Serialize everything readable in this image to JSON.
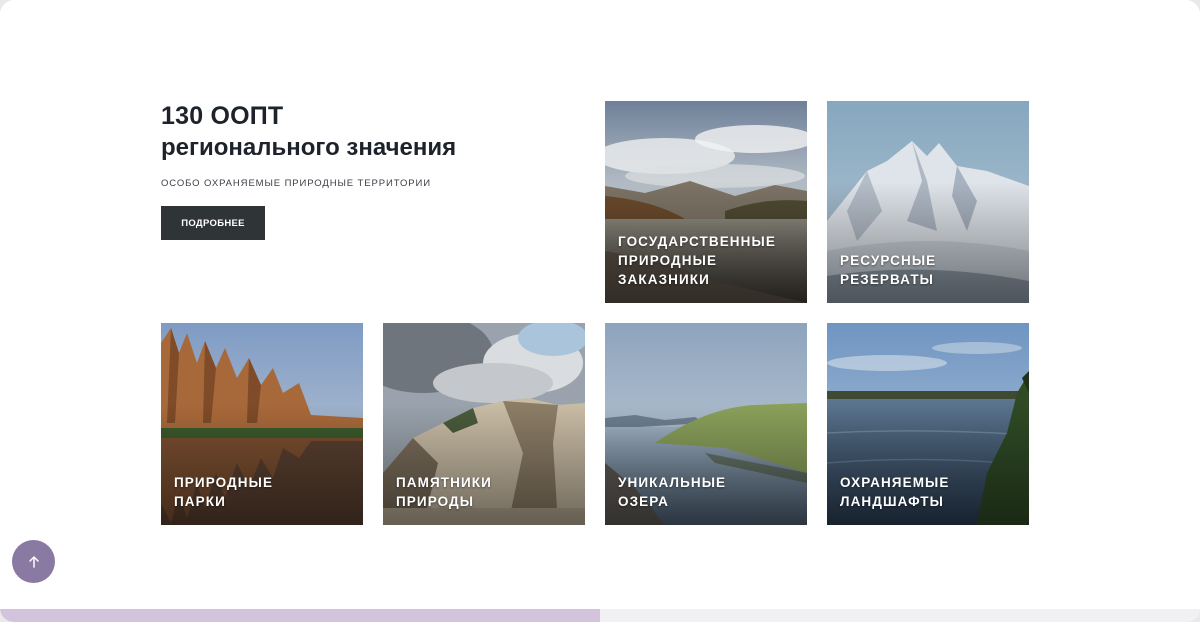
{
  "intro": {
    "title_line1": "130 ООПТ",
    "title_line2": "регионального значения",
    "subtitle": "ОСОБО ОХРАНЯЕМЫЕ ПРИРОДНЫЕ ТЕРРИТОРИИ",
    "more_button": "ПОДРОБНЕЕ"
  },
  "tiles": [
    {
      "id": "zakazniki",
      "lines": [
        "ГОСУДАРСТВЕННЫЕ",
        "ПРИРОДНЫЕ",
        "ЗАКАЗНИКИ"
      ]
    },
    {
      "id": "rezervaty",
      "lines": [
        "РЕСУРСНЫЕ",
        "РЕЗЕРВАТЫ"
      ]
    },
    {
      "id": "parki",
      "lines": [
        "ПРИРОДНЫЕ",
        "ПАРКИ"
      ]
    },
    {
      "id": "pamyatniki",
      "lines": [
        "ПАМЯТНИКИ",
        "ПРИРОДЫ"
      ]
    },
    {
      "id": "ozera",
      "lines": [
        "УНИКАЛЬНЫЕ",
        "ОЗЕРА"
      ]
    },
    {
      "id": "landshafty",
      "lines": [
        "ОХРАНЯЕМЫЕ",
        "ЛАНДШАФТЫ"
      ]
    }
  ],
  "scroll_button": {
    "icon": "arrow-up-icon"
  },
  "scroll_progress": {
    "fraction": 0.5
  },
  "colors": {
    "button_dark": "#2f3437",
    "scroll_button": "#8a7aa3",
    "progress_fill": "#d3c3dd"
  }
}
